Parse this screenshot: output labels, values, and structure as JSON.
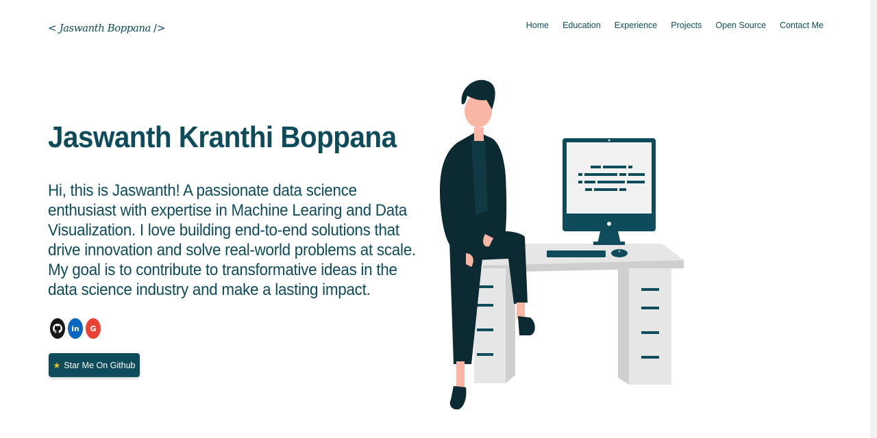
{
  "logo": {
    "open_bracket": "<",
    "signature": "Jaswanth Boppana",
    "close_bracket": "/>"
  },
  "nav": {
    "items": [
      "Home",
      "Education",
      "Experience",
      "Projects",
      "Open Source",
      "Contact Me"
    ]
  },
  "hero": {
    "name": "Jaswanth Kranthi Boppana",
    "intro": "Hi, this is Jaswanth! A passionate data science enthusiast with expertise in Machine Learing and Data Visualization. I love building end-to-end solutions that drive innovation and solve real-world problems at scale. My goal is to contribute to transformative ideas in the data science industry and make a lasting impact.",
    "socials": [
      {
        "name": "github-icon",
        "glyph": "◐",
        "color": "#181717"
      },
      {
        "name": "linkedin-icon",
        "glyph": "in",
        "color": "#0a66c2"
      },
      {
        "name": "google-icon",
        "glyph": "G",
        "color": "#ea4335"
      }
    ],
    "star_button": {
      "icon": "star-icon",
      "label": "Star Me On Github"
    }
  },
  "colors": {
    "primary": "#0e4c5c",
    "background": "#ffffff",
    "skin": "#f9b6a5",
    "desk": "#e6e6e6"
  }
}
